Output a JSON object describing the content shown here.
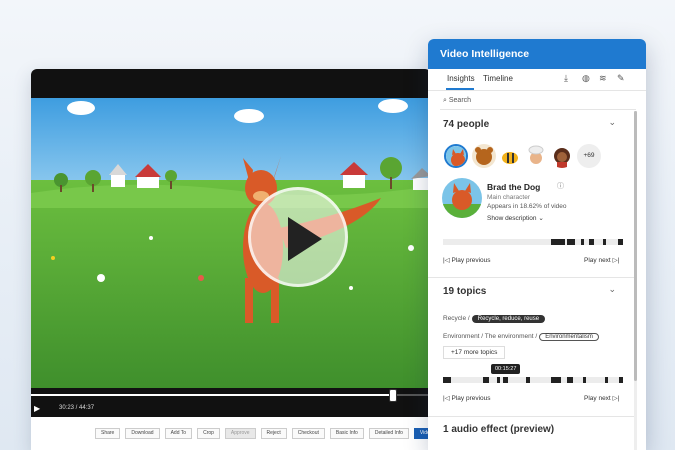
{
  "player": {
    "current_time": "30:23",
    "total_time": "44:37",
    "progress": 0.9,
    "actions": [
      "Share",
      "Download",
      "Add To",
      "Crop",
      "Approve",
      "Reject",
      "Checkout",
      "Basic Info",
      "Detailed Info",
      "Video Intel"
    ]
  },
  "panel": {
    "title": "Video Intelligence",
    "tabs": [
      "Insights",
      "Timeline"
    ],
    "active_tab": "Insights",
    "icons": [
      "download-icon",
      "globe-icon",
      "layers-icon",
      "edit-icon"
    ],
    "search_placeholder": "Search",
    "people": {
      "heading": "74 people",
      "more_count": "+69",
      "selected": {
        "name": "Brad the Dog",
        "role": "Main character",
        "appears": "Appears in 18.62% of video",
        "show_description": "Show description"
      },
      "play_previous": "Play previous",
      "play_next": "Play next"
    },
    "topics": {
      "heading": "19 topics",
      "row1_prefix": "Recycle /",
      "row1_pill": "Recycle, reduce, reuse",
      "row2_prefix": "Environment / The environment /",
      "row2_pill": "Environmentalism",
      "more": "+17 more topics",
      "tooltip_time": "00:15:27",
      "play_previous": "Play previous",
      "play_next": "Play next"
    },
    "audio": {
      "heading": "1 audio effect (preview)"
    }
  },
  "colors": {
    "accent": "#1f7ad0",
    "header_blue": "#1f7ad0",
    "primary_button": "#1a5fb4"
  }
}
